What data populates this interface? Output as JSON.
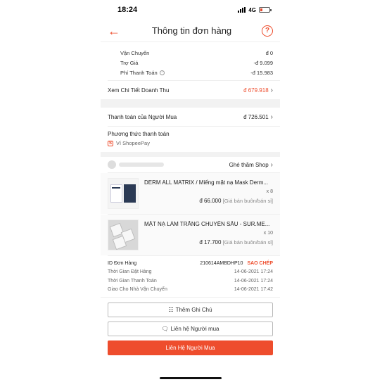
{
  "status": {
    "time": "18:24",
    "network": "4G"
  },
  "nav": {
    "title": "Thông tin đơn hàng",
    "help_symbol": "?"
  },
  "fees": [
    {
      "label": "Vận Chuyển",
      "value": "đ 0",
      "info": false
    },
    {
      "label": "Trợ Giá",
      "value": "-đ 9.099",
      "info": false
    },
    {
      "label": "Phí Thanh Toán",
      "value": "-đ 15.983",
      "info": true
    }
  ],
  "revenue": {
    "label": "Xem Chi Tiết Doanh Thu",
    "value": "đ 679.918"
  },
  "buyer_payment": {
    "label": "Thanh toán của Người Mua",
    "value": "đ 726.501"
  },
  "payment_method": {
    "title": "Phương thức thanh toán",
    "method": "Ví ShopeePay"
  },
  "shop": {
    "visit_label": "Ghé thăm Shop"
  },
  "products": [
    {
      "name": "DERM ALL MATRIX / Miếng mặt nạ Mask Derm...",
      "qty": "x 8",
      "price": "đ 66.000",
      "price_note": "[Giá bán buôn/bán sỉ]"
    },
    {
      "name": "MẶT NẠ LÀM TRẮNG CHUYÊN SÂU - SUR.ME...",
      "qty": "x 10",
      "price": "đ 17.700",
      "price_note": "[Giá bán buôn/bán sỉ]"
    }
  ],
  "order": {
    "id_label": "ID Đơn Hàng",
    "id_value": "210614AMBDHP10",
    "copy_label": "SAO CHÉP",
    "rows": [
      {
        "label": "Thời Gian Đặt Hàng",
        "value": "14-06-2021 17:24"
      },
      {
        "label": "Thời Gian Thanh Toán",
        "value": "14-06-2021 17:24"
      },
      {
        "label": "Giao Cho Nhà Vận Chuyển",
        "value": "14-06-2021 17:42"
      }
    ]
  },
  "actions": {
    "add_note": "Thêm Ghi Chú",
    "contact_buyer_chat": "Liên hệ Người mua",
    "contact_buyer": "Liên Hệ Người Mua"
  },
  "colors": {
    "accent": "#ee4d2d"
  }
}
